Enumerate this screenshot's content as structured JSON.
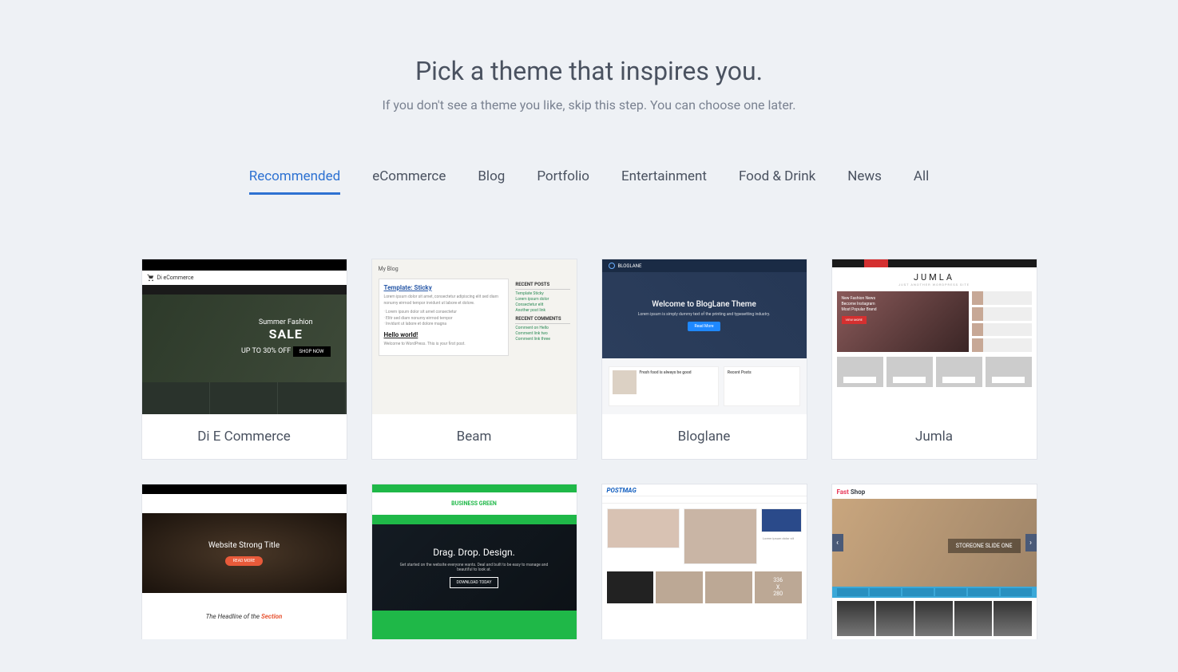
{
  "header": {
    "title": "Pick a theme that inspires you.",
    "subtitle": "If you don't see a theme you like, skip this step. You can choose one later."
  },
  "tabs": [
    {
      "label": "Recommended",
      "active": true
    },
    {
      "label": "eCommerce",
      "active": false
    },
    {
      "label": "Blog",
      "active": false
    },
    {
      "label": "Portfolio",
      "active": false
    },
    {
      "label": "Entertainment",
      "active": false
    },
    {
      "label": "Food & Drink",
      "active": false
    },
    {
      "label": "News",
      "active": false
    },
    {
      "label": "All",
      "active": false
    }
  ],
  "themes": [
    {
      "name": "Di E Commerce"
    },
    {
      "name": "Beam"
    },
    {
      "name": "Bloglane"
    },
    {
      "name": "Jumla"
    },
    {
      "name": ""
    },
    {
      "name": ""
    },
    {
      "name": ""
    },
    {
      "name": ""
    }
  ],
  "thumbs": {
    "di": {
      "brand": "Di eCommerce",
      "sale_small": "Summer Fashion",
      "sale": "SALE",
      "sale_sub": "UP TO 30% OFF",
      "btn": "SHOP NOW"
    },
    "beam": {
      "site": "My Blog",
      "h1": "Template: Sticky",
      "h2": "Hello world!",
      "recent": "RECENT POSTS",
      "comments": "RECENT COMMENTS"
    },
    "bloglane": {
      "brand": "BLOGLANE",
      "title": "Welcome to BlogLane Theme",
      "sub": "Lorem ipsum is simply dummy text of the printing and typesetting industry.",
      "btn": "Read More",
      "post": "Fresh food is always be good",
      "recent": "Recent Posts"
    },
    "jumla": {
      "brand": "JUMLA",
      "tagline": "JUST ANOTHER WORDPRESS SITE",
      "btn": "VIEW MORE"
    },
    "gourmand": {
      "title": "Website Strong Title",
      "headline_a": "The Headline of the ",
      "headline_b": "Section"
    },
    "green": {
      "brand": "BUSINESS GREEN",
      "title": "Drag. Drop. Design.",
      "btn": "DOWNLOAD TODAY"
    },
    "postmag": {
      "brand": "POSTMAG",
      "ad": "336\nX\n280"
    },
    "fast": {
      "brand_a": "Fast",
      "brand_b": "Shop",
      "slide": "STOREONE SLIDE ONE"
    }
  }
}
